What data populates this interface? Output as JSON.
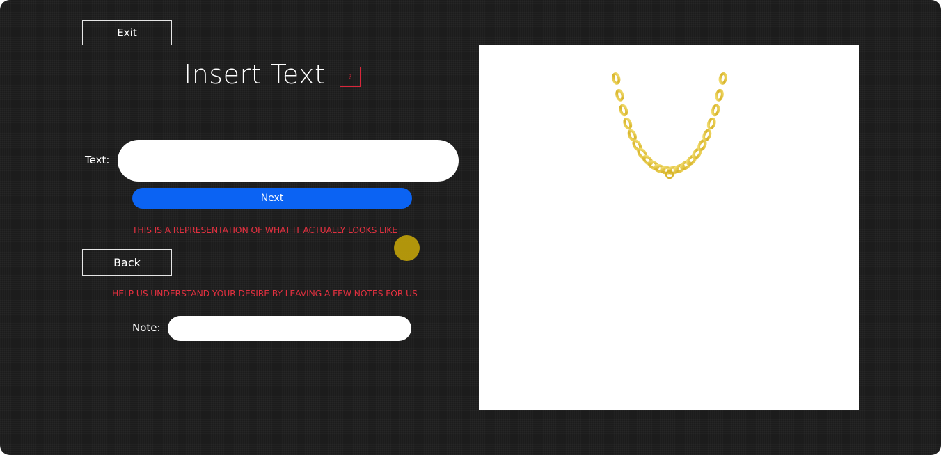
{
  "header": {
    "exit_label": "Exit",
    "title": "Insert Text",
    "help_label": "?"
  },
  "form": {
    "text_label": "Text:",
    "text_value": "",
    "next_label": "Next",
    "representation_notice": "THIS IS A REPRESENTATION OF WHAT IT ACTUALLY LOOKS LIKE",
    "back_label": "Back",
    "notes_prompt": "HELP US UNDERSTAND YOUR DESIRE BY LEAVING A FEW NOTES FOR US",
    "note_label": "Note:",
    "note_value": ""
  },
  "preview": {
    "image": "gold-chain-necklace"
  },
  "colors": {
    "background": "#1c1c1c",
    "accent_blue": "#0b63f3",
    "warning_red": "#e0303f",
    "gold": "#e6c93a"
  }
}
